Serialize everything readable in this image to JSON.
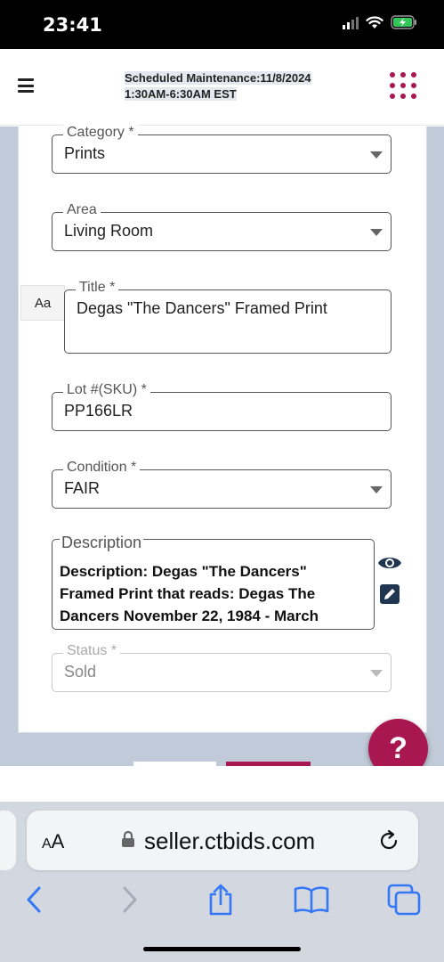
{
  "status_bar": {
    "time": "23:41"
  },
  "header": {
    "notice_line1": "Scheduled Maintenance:11/8/2024",
    "notice_line2": "1:30AM-6:30AM EST"
  },
  "form": {
    "category": {
      "label": "Category *",
      "value": "Prints"
    },
    "area": {
      "label": "Area",
      "value": "Living Room"
    },
    "format_button": "Aa",
    "title": {
      "label": "Title *",
      "value": "Degas \"The Dancers\" Framed Print"
    },
    "lot": {
      "label": "Lot #(SKU) *",
      "value": "PP166LR"
    },
    "condition": {
      "label": "Condition *",
      "value": "FAIR"
    },
    "description": {
      "label": "Description",
      "value": "Description: Degas \"The Dancers\" Framed Print that reads: Degas The Dancers November 22, 1984 - March"
    },
    "status": {
      "label": "Status *",
      "value": "Sold"
    }
  },
  "help_button": "?",
  "browser": {
    "aa_label_big": "A",
    "aa_label_small": "A",
    "url": "seller.ctbids.com"
  },
  "colors": {
    "brand": "#a8174f",
    "navy": "#1f3550",
    "ios_blue": "#3478f6"
  }
}
